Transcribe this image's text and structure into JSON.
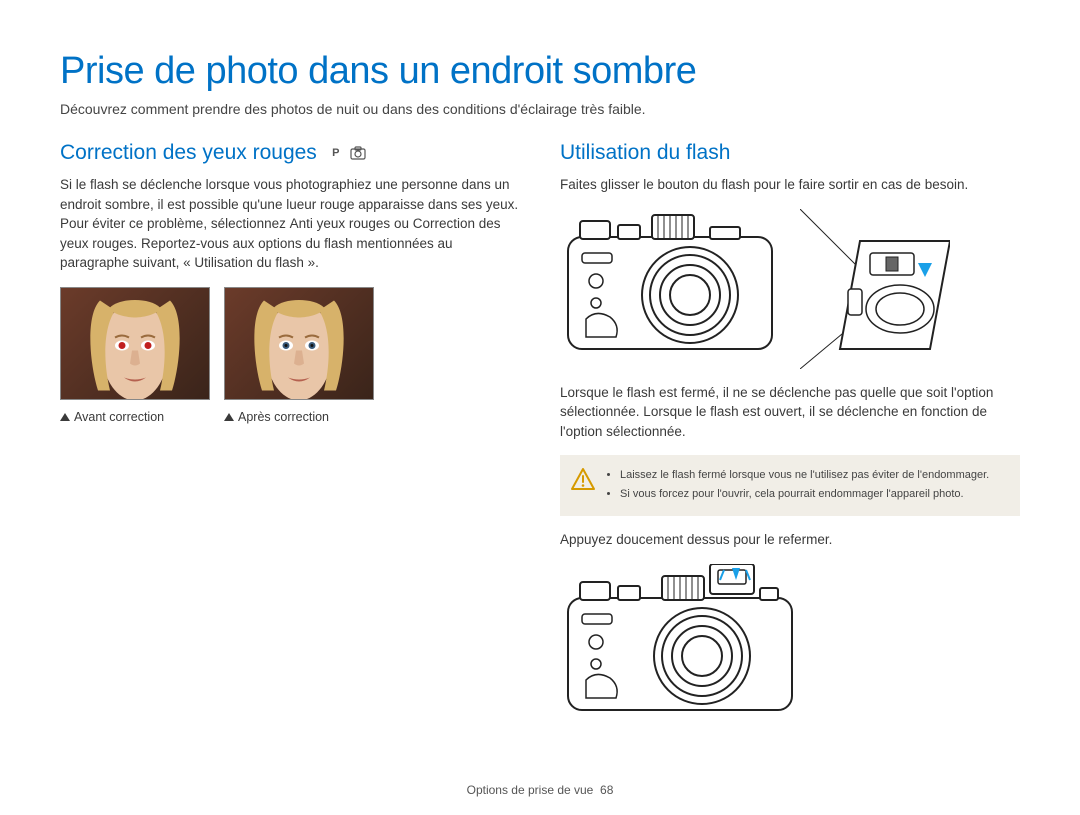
{
  "title": "Prise de photo dans un endroit sombre",
  "intro": "Découvrez comment prendre des photos de nuit ou dans des conditions d'éclairage très faible.",
  "left": {
    "heading": "Correction des yeux rouges",
    "mode_p": "P",
    "body_part1": "Si le flash se déclenche lorsque vous photographiez une personne dans un endroit sombre, il est possible qu'une lueur rouge apparaisse dans ses yeux. Pour éviter ce problème, sélectionnez ",
    "body_bold1": "Anti yeux rouges",
    "body_mid": " ou ",
    "body_bold2": "Correction des yeux rouges",
    "body_part2": ". Reportez-vous aux options du flash mentionnées au paragraphe suivant, « Utilisation du flash ».",
    "caption_before": "Avant correction",
    "caption_after": "Après correction"
  },
  "right": {
    "heading": "Utilisation du flash",
    "p1": "Faites glisser le bouton du flash pour le faire sortir en cas de besoin.",
    "p2": "Lorsque le flash est fermé, il ne se déclenche pas quelle que soit l'option sélectionnée. Lorsque le flash est ouvert, il se déclenche en fonction de l'option sélectionnée.",
    "note1": "Laissez le flash fermé lorsque vous ne l'utilisez pas éviter de l'endommager.",
    "note2": "Si vous forcez pour l'ouvrir, cela pourrait endommager l'appareil photo.",
    "p3": "Appuyez doucement dessus pour le refermer."
  },
  "footer_label": "Options de prise de vue",
  "page_number": "68"
}
